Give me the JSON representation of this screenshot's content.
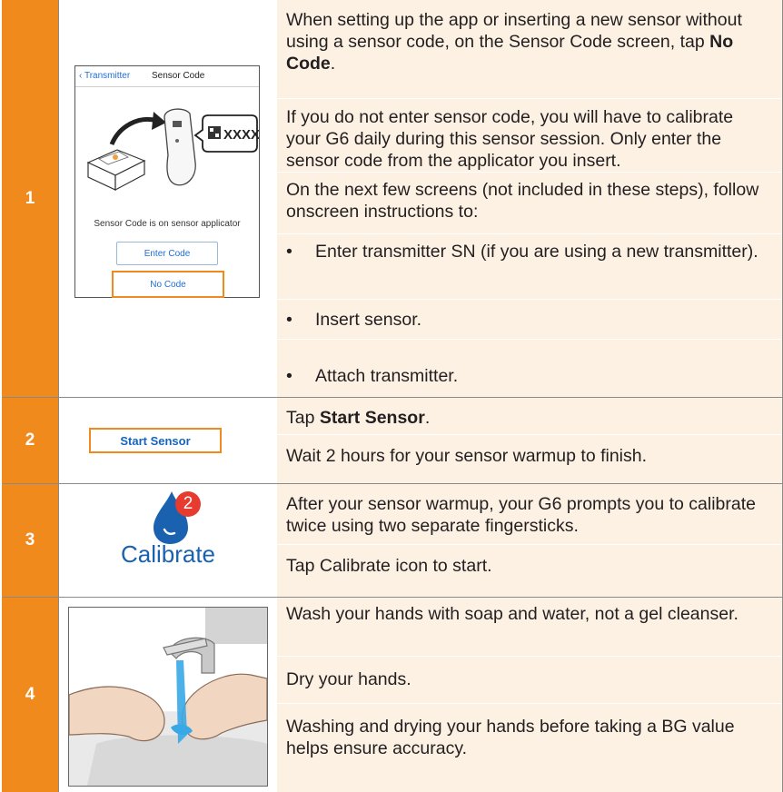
{
  "rows": [
    {
      "step": "1",
      "phone": {
        "back_label": "Transmitter",
        "title": "Sensor Code",
        "code_tag": "XXXX",
        "caption": "Sensor Code is on sensor applicator",
        "enter_button": "Enter Code",
        "no_code_button": "No Code"
      },
      "p1_pre": "When setting up the app or inserting a new sensor without using a sensor code, on the Sensor Code screen, tap ",
      "p1_bold": "No Code",
      "p1_post": ".",
      "p2": "If you do not enter sensor code, you will have to calibrate your G6 daily during this sensor session. Only enter the sensor code from the applicator you insert.",
      "p3": "On the next few screens (not included in these steps), follow onscreen instructions to:",
      "bullets": [
        "Enter transmitter SN (if you are using a new transmitter).",
        "Insert sensor.",
        "Attach transmitter."
      ]
    },
    {
      "step": "2",
      "button_label": "Start Sensor",
      "p1_pre": "Tap ",
      "p1_bold": "Start Sensor",
      "p1_post": ".",
      "p2": "Wait 2 hours for your sensor warmup to finish."
    },
    {
      "step": "3",
      "badge": "2",
      "icon_label": "Calibrate",
      "p1": "After your sensor warmup, your G6 prompts you to calibrate twice using two separate fingersticks.",
      "p2": "Tap Calibrate icon to start."
    },
    {
      "step": "4",
      "p1": "Wash your hands with soap and water, not a gel cleanser.",
      "p2": "Dry your hands.",
      "p3": "Washing and drying your hands before taking a BG value helps ensure accuracy."
    }
  ],
  "colors": {
    "step_bg": "#f08a1d",
    "text_bg": "#fdf1e3",
    "link_blue": "#1f6ed4"
  },
  "bullet_glyph": "•"
}
